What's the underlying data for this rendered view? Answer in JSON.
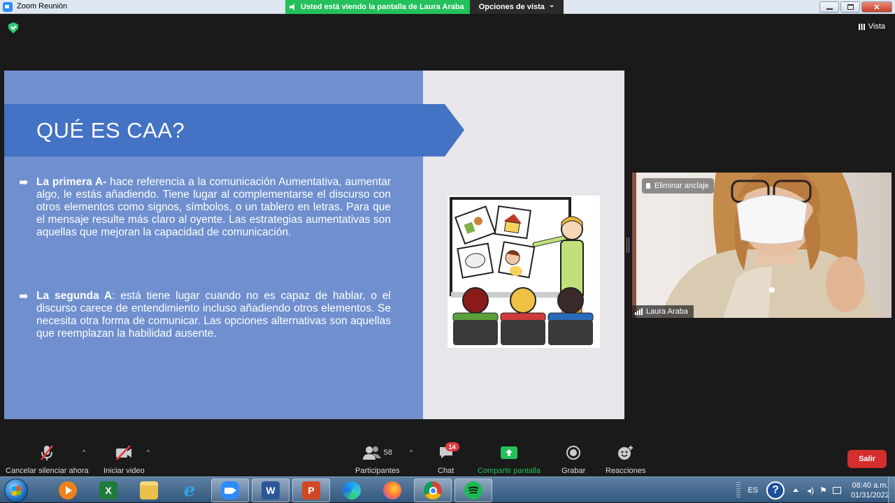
{
  "window": {
    "title": "Zoom Reunión",
    "share_banner": "Usted está viendo la pantalla de Laura Araba",
    "view_options": "Opciones de vista",
    "view_options_caret": "⌄"
  },
  "top_right": {
    "view_label": "Vista"
  },
  "slide": {
    "title": "QUÉ ES CAA?",
    "bullets": [
      {
        "lead": "La primera A-",
        "text": " hace referencia a la comunicación Aumentativa, aumentar algo, le estás añadiendo. Tiene lugar al complementarse el discurso con otros elementos como signos, símbolos, o un tablero en letras. Para que el mensaje resulte más claro al oyente. Las estrategias aumentativas son aquellas que mejoran la capacidad de comunicación."
      },
      {
        "lead": "La segunda A",
        "text": ": está tiene lugar cuando no es capaz de hablar, o el discurso carece de entendimiento incluso añadiendo otros elementos. Se necesita otra forma de comunicar. Las opciones alternativas son aquellas que reemplazan la habilidad ausente."
      }
    ]
  },
  "video": {
    "pin_label": "Eliminar anclaje",
    "participant_name": "Laura Araba"
  },
  "toolbar": {
    "mute_label": "Cancelar silenciar ahora",
    "video_label": "Iniciar video",
    "participants_label": "Participantes",
    "participants_count": "58",
    "chat_label": "Chat",
    "chat_badge": "14",
    "share_label": "Compartir pantalla",
    "record_label": "Grabar",
    "reactions_label": "Reacciones",
    "leave_label": "Salir",
    "caret": "^",
    "share_color": "#23c05b",
    "leave_color": "#d32f2f"
  },
  "taskbar": {
    "apps": [
      "windows-media-player",
      "excel",
      "file-explorer",
      "internet-explorer",
      "zoom",
      "word",
      "powerpoint",
      "edge",
      "firefox",
      "chrome",
      "spotify"
    ],
    "excel_letter": "X",
    "word_letter": "W",
    "powerpoint_letter": "P",
    "tray": {
      "language": "ES",
      "help": "?",
      "time": "08:40 a.m.",
      "date": "01/31/2022"
    }
  }
}
